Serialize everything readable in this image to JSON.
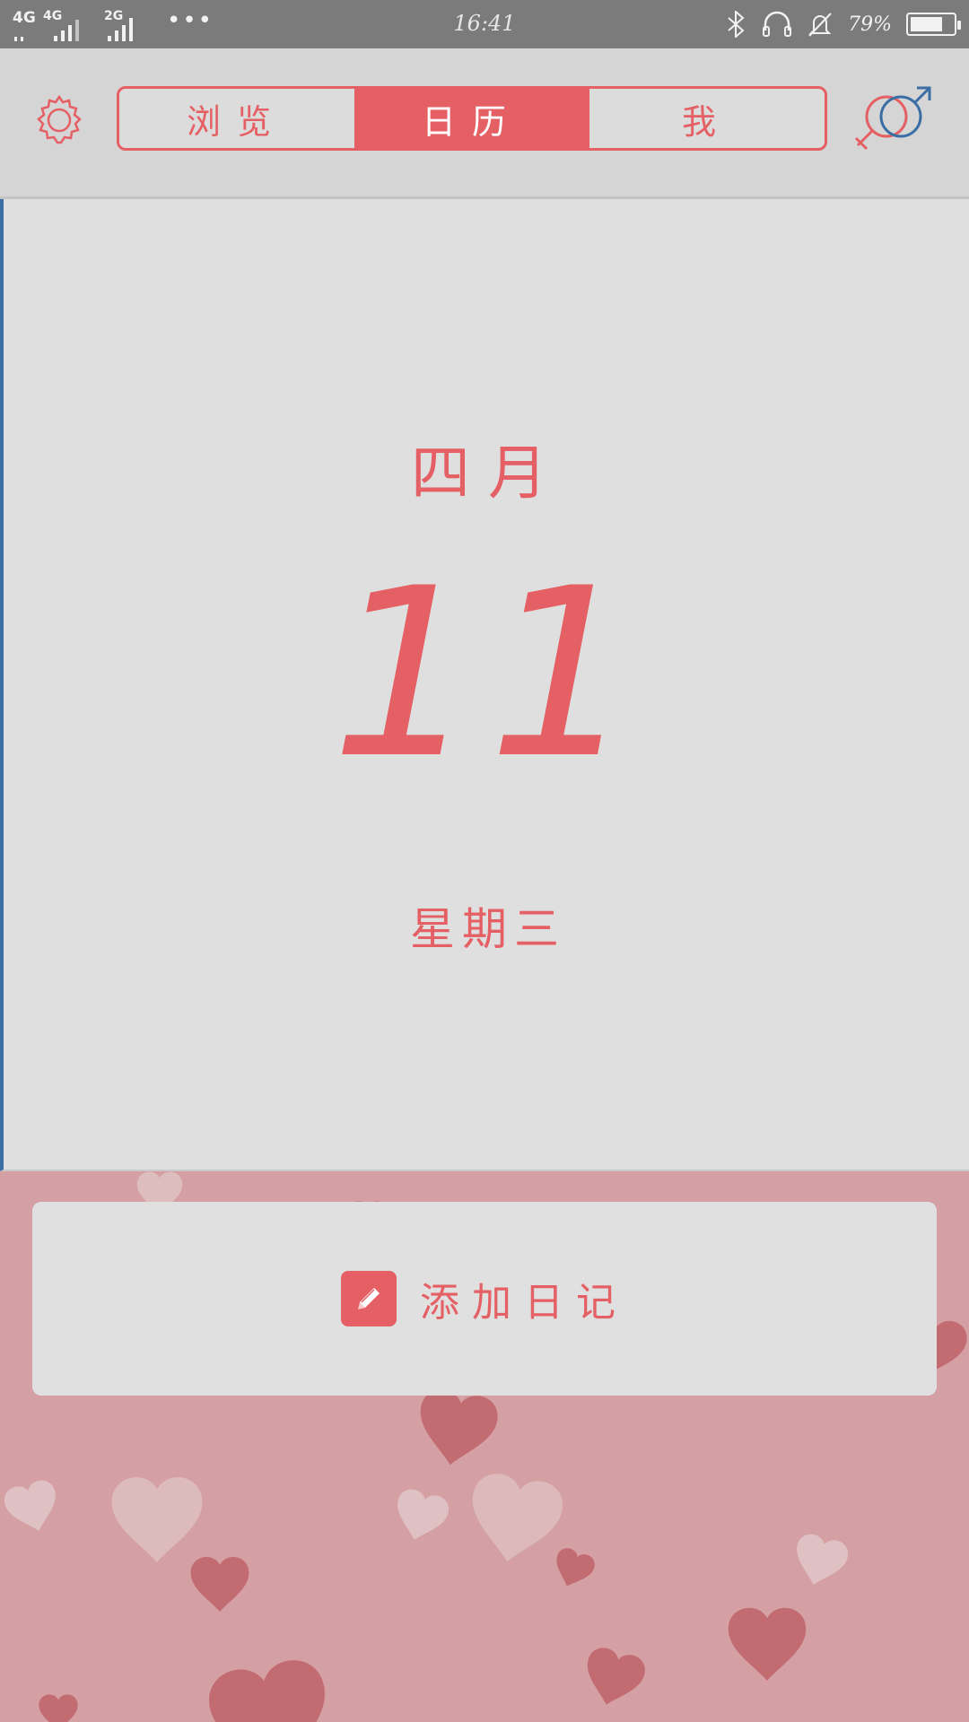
{
  "status_bar": {
    "signal1_label": "4G",
    "signal2_label": "4G",
    "signal3_label": "2G",
    "overflow": "•••",
    "time": "16:41",
    "battery_text": "79%",
    "battery_level": 0.79
  },
  "header": {
    "tabs": [
      {
        "label": "浏览",
        "active": false
      },
      {
        "label": "日历",
        "active": true
      },
      {
        "label": "我",
        "active": false
      }
    ],
    "settings_icon": "gear-icon",
    "gender_icon": "gender-icon"
  },
  "calendar": {
    "month": "四月",
    "day": "11",
    "weekday": "星期三"
  },
  "diary": {
    "icon": "pencil-icon",
    "label": "添加日记"
  },
  "colors": {
    "accent": "#e56065",
    "male_blue": "#3a6ea5",
    "panel": "#dfdfdf",
    "hearts_bg": "#d4a0a4"
  }
}
